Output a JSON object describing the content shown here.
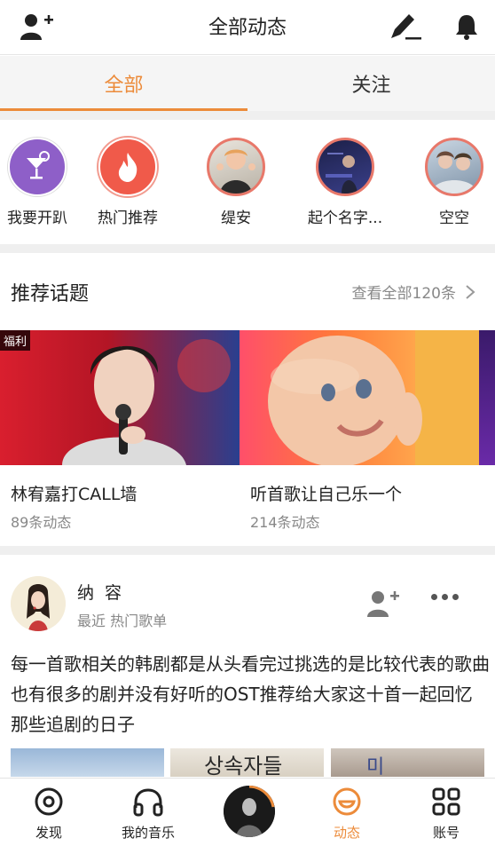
{
  "header": {
    "title": "全部动态",
    "left_icon": "add-friend-icon",
    "right_icons": [
      "compose-icon",
      "bell-icon"
    ]
  },
  "tabs": [
    {
      "label": "全部",
      "active": true
    },
    {
      "label": "关注",
      "active": false
    }
  ],
  "shortcuts": [
    {
      "label": "我要开趴",
      "icon": "cocktail-icon",
      "color": "#8e5fc8"
    },
    {
      "label": "热门推荐",
      "icon": "flame-icon",
      "color": "#f05a4a"
    },
    {
      "label": "缇安",
      "icon": "avatar"
    },
    {
      "label": "起个名字...",
      "icon": "avatar"
    },
    {
      "label": "空空",
      "icon": "avatar"
    }
  ],
  "topics": {
    "heading": "推荐话题",
    "more_label": "查看全部120条",
    "items": [
      {
        "badge": "福利",
        "name": "林宥嘉打CALL墙",
        "count": "89条动态"
      },
      {
        "name": "听首歌让自己乐一个",
        "count": "214条动态"
      },
      {
        "name": "",
        "count": ""
      }
    ]
  },
  "post": {
    "username": "纳 容",
    "meta": "最近 热门歌单",
    "text": "每一首歌相关的韩剧都是从头看完过挑选的是比较代表的歌曲也有很多的剧并没有好听的OST推荐给大家这十首一起回忆那些追剧的日子"
  },
  "bottom_nav": [
    {
      "label": "发现",
      "icon": "discover-icon",
      "active": false
    },
    {
      "label": "我的音乐",
      "icon": "headphones-icon",
      "active": false
    },
    {
      "label": "动态",
      "icon": "feed-icon",
      "active": true
    },
    {
      "label": "账号",
      "icon": "grid-icon",
      "active": false
    }
  ],
  "colors": {
    "accent": "#ec8b3a"
  }
}
